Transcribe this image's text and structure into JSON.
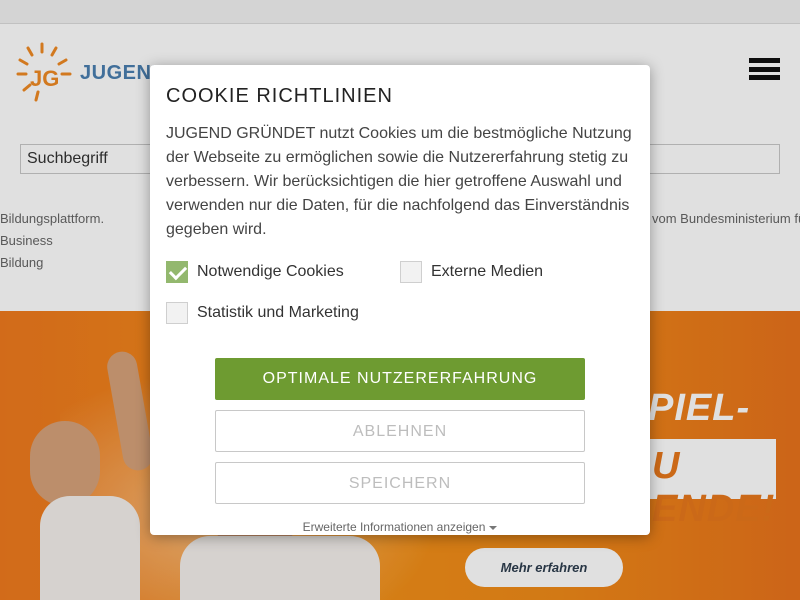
{
  "header": {
    "brand_text": "JUGEND",
    "menu_icon": "hamburger-menu-icon"
  },
  "search": {
    "placeholder": "Suchbegriff"
  },
  "disclaimer": {
    "left_line1": "Bildungsplattform. Business",
    "left_line2": "Bildung",
    "right_line1": "vom Bundesministerium für"
  },
  "hero": {
    "headline1": "PIEL-",
    "headline2": "U ENDE!",
    "more_button": "Mehr erfahren"
  },
  "cookie_modal": {
    "title": "COOKIE RICHTLINIEN",
    "text": "JUGEND GRÜNDET nutzt Cookies um die bestmögliche Nutzung der Webseite zu ermöglichen sowie die Nutzererfahrung stetig zu verbessern. Wir berücksichtigen die hier getroffene Auswahl und verwenden nur die Daten, für die nachfolgend das Einverständnis gegeben wird.",
    "options": [
      {
        "label": "Notwendige Cookies",
        "checked": true
      },
      {
        "label": "Externe Medien",
        "checked": false
      },
      {
        "label": "Statistik und Marketing",
        "checked": false
      }
    ],
    "accept_button": "OPTIMALE NUTZERERFAHRUNG",
    "deny_button": "ABLEHNEN",
    "save_button": "SPEICHERN",
    "more_info": "Erweiterte Informationen anzeigen"
  },
  "colors": {
    "accent_green": "#6e9b31",
    "checkbox_green": "#93b86e",
    "hero_orange": "#f39018",
    "brand_blue": "#4a7fb0"
  }
}
